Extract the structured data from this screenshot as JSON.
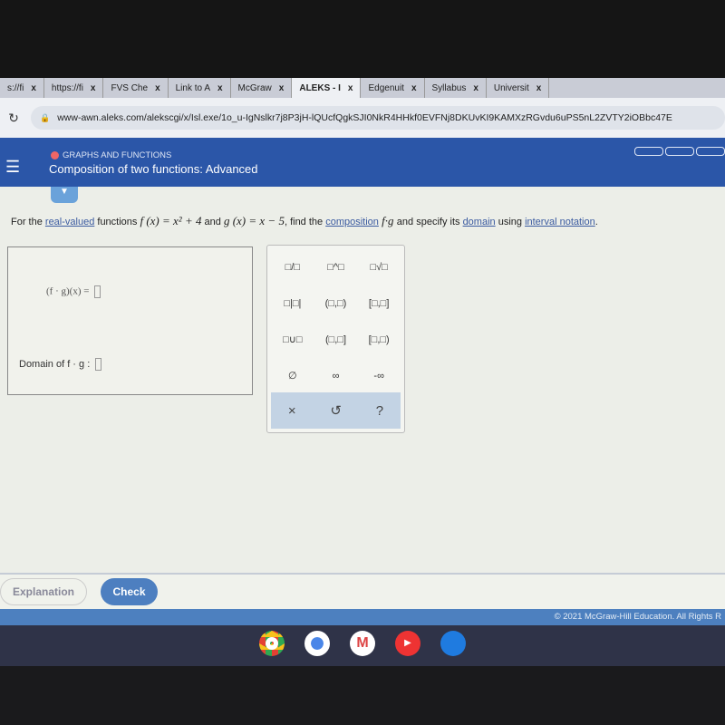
{
  "browser": {
    "tabs": [
      {
        "label": "s://fi",
        "active": false
      },
      {
        "label": "https://fi",
        "active": false
      },
      {
        "label": "FVS Che",
        "active": false
      },
      {
        "label": "Link to A",
        "active": false
      },
      {
        "label": "McGraw",
        "active": false
      },
      {
        "label": "ALEKS - I",
        "active": true
      },
      {
        "label": "Edgenuit",
        "active": false
      },
      {
        "label": "Syllabus",
        "active": false
      },
      {
        "label": "Universit",
        "active": false
      }
    ],
    "close_glyph": "x",
    "url": "www-awn.aleks.com/alekscgi/x/Isl.exe/1o_u-IgNslkr7j8P3jH-lQUcfQgkSJI0NkR4HHkf0EVFNj8DKUvKI9KAMXzRGvdu6uPS5nL2ZVTY2iOBbc47E"
  },
  "header": {
    "topic": "GRAPHS AND FUNCTIONS",
    "title": "Composition of two functions: Advanced"
  },
  "question": {
    "p1": "For the ",
    "link1": "real-valued",
    "p2": " functions ",
    "f": "f (x) = x² + 4",
    "p3": " and ",
    "g": "g (x) = x − 5",
    "p4": ", find the ",
    "link2": "composition",
    "p5": " f·g ",
    "p6": "and specify its ",
    "link3": "domain",
    "p7": " using ",
    "link4": "interval notation",
    "p8": "."
  },
  "answer": {
    "composition_label": "(f · g)(x) =",
    "domain_label": "Domain of f · g :"
  },
  "keypad": {
    "keys": [
      "□/□",
      "□^□",
      "□√□",
      "□|□|",
      "(□,□)",
      "[□,□]",
      "□∪□",
      "(□,□]",
      "[□,□)",
      "∅",
      "∞",
      "-∞"
    ],
    "clear": "×",
    "undo": "↺",
    "help": "?"
  },
  "footer": {
    "explanation": "Explanation",
    "check": "Check",
    "copyright": "© 2021 McGraw-Hill Education. All Rights R"
  },
  "colors": {
    "header": "#2b56a8",
    "check": "#4d7fc0"
  }
}
